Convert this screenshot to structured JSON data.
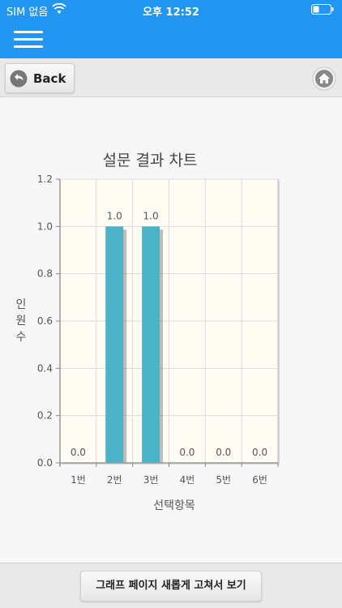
{
  "status_bar": {
    "carrier": "SIM 없음",
    "time": "오후 12:52"
  },
  "toolbar": {
    "back_label": "Back"
  },
  "bottom": {
    "refresh_label": "그래프 페이지 새롭게 고쳐서 보기"
  },
  "colors": {
    "primary": "#2196f3",
    "bar": "#4bb3c8",
    "plot_bg": "#fffdf3"
  },
  "icons": [
    "wifi-icon",
    "battery-icon",
    "menu-icon",
    "back-arrow-icon",
    "home-icon"
  ],
  "chart_data": {
    "type": "bar",
    "title": "설문 결과 차트",
    "xlabel": "선택항목",
    "ylabel": "인원수",
    "ylabel_chars": [
      "인",
      "원",
      "수"
    ],
    "categories": [
      "1번",
      "2번",
      "3번",
      "4번",
      "5번",
      "6번"
    ],
    "values": [
      0.0,
      1.0,
      1.0,
      0.0,
      0.0,
      0.0
    ],
    "value_labels": [
      "0.0",
      "1.0",
      "1.0",
      "0.0",
      "0.0",
      "0.0"
    ],
    "ylim": [
      0,
      1.2
    ],
    "y_ticks": [
      0.0,
      0.2,
      0.4,
      0.6,
      0.8,
      1.0,
      1.2
    ],
    "y_tick_labels": [
      "0.0",
      "0.2",
      "0.4",
      "0.6",
      "0.8",
      "1.0",
      "1.2"
    ],
    "grid": true,
    "legend": "none"
  }
}
